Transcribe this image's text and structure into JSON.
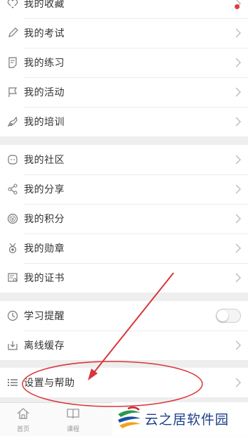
{
  "groups": [
    {
      "items": [
        {
          "label": "我的收藏",
          "icon": "heart-icon"
        },
        {
          "label": "我的考试",
          "icon": "pencil-icon"
        },
        {
          "label": "我的练习",
          "icon": "document-icon"
        },
        {
          "label": "我的活动",
          "icon": "flag-icon"
        },
        {
          "label": "我的培训",
          "icon": "training-icon"
        }
      ]
    },
    {
      "items": [
        {
          "label": "我的社区",
          "icon": "chat-icon"
        },
        {
          "label": "我的分享",
          "icon": "share-icon"
        },
        {
          "label": "我的积分",
          "icon": "coin-icon"
        },
        {
          "label": "我的勋章",
          "icon": "medal-icon"
        },
        {
          "label": "我的证书",
          "icon": "certificate-icon"
        }
      ]
    },
    {
      "items": [
        {
          "label": "学习提醒",
          "icon": "clock-icon",
          "toggle": false
        },
        {
          "label": "离线缓存",
          "icon": "download-icon"
        }
      ]
    },
    {
      "items": [
        {
          "label": "设置与帮助",
          "icon": "list-icon"
        }
      ]
    }
  ],
  "tabbar": {
    "home": "首页",
    "courses": "课程"
  },
  "watermark": {
    "text": "云之居软件园"
  },
  "colors": {
    "annotation": "#d9353a",
    "notification_dot": "#e53b3b"
  }
}
